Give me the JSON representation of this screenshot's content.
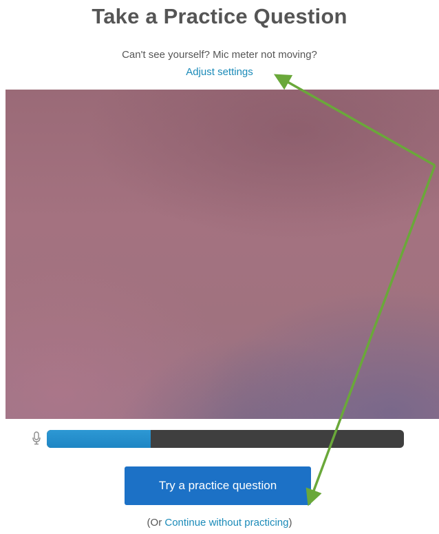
{
  "page": {
    "title": "Take a Practice Question",
    "hint": "Can't see yourself? Mic meter not moving?",
    "adjust_link": "Adjust settings"
  },
  "mic": {
    "icon": "microphone-icon",
    "level": 0.29
  },
  "actions": {
    "try_button": "Try a practice question",
    "continue_prefix": "(Or ",
    "continue_link": "Continue without practicing",
    "continue_suffix": ")"
  },
  "colors": {
    "link": "#1a8ab8",
    "button": "#1c71c6",
    "meter_fill": "#1e86c4",
    "meter_track": "#3f3f3f",
    "annotation_arrow": "#6aa83a"
  }
}
